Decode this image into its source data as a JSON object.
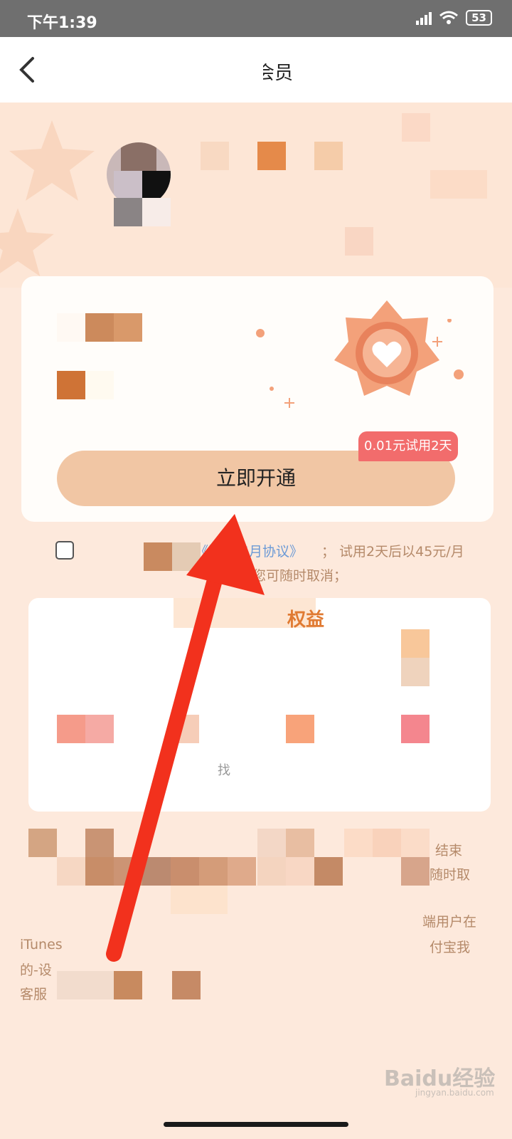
{
  "status_bar": {
    "time": "下午1:39",
    "battery": "53"
  },
  "nav": {
    "title": "心悦会员"
  },
  "card": {
    "open_label": "立即开通",
    "trial_badge": "0.01元试用2天"
  },
  "agreement": {
    "link_text": "《连续包月协议》",
    "text": "；  试用2天后以45元/月",
    "text2": "您可随时取消；"
  },
  "benefits": {
    "title": "权益",
    "label": "找"
  },
  "terms": {
    "line1_end": "结束",
    "line2_end": "随时取",
    "line3_end": "端用户在",
    "line4_start": "iTunes",
    "line4_end": "付宝我",
    "line5_start": "的-设",
    "line6_start": "客服"
  },
  "watermark": {
    "main": "Baidu经验",
    "sub": "jingyan.baidu.com"
  }
}
